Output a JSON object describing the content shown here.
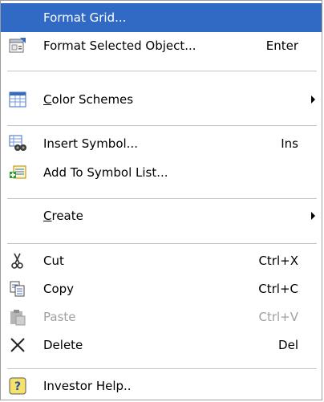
{
  "menu": {
    "format_grid": {
      "label": "Format Grid..."
    },
    "format_selected": {
      "label": "Format Selected Object...",
      "shortcut": "Enter"
    },
    "color_schemes": {
      "label_pre": "",
      "label_accel": "C",
      "label_post": "olor Schemes"
    },
    "insert_symbol": {
      "label": "Insert Symbol...",
      "shortcut": "Ins"
    },
    "add_symbol": {
      "label": "Add To Symbol List..."
    },
    "create": {
      "label_pre": "",
      "label_accel": "C",
      "label_post": "reate"
    },
    "cut": {
      "label": "Cut",
      "shortcut": "Ctrl+X"
    },
    "copy": {
      "label": "Copy",
      "shortcut": "Ctrl+C"
    },
    "paste": {
      "label": "Paste",
      "shortcut": "Ctrl+V",
      "disabled": true
    },
    "delete": {
      "label": "Delete",
      "shortcut": "Del"
    },
    "investor_help": {
      "label": "Investor Help.."
    }
  },
  "colors": {
    "highlight": "#316ac5",
    "disabled_text": "#a0a0a0",
    "separator": "#c5c5c5"
  },
  "icons": {
    "format_selected": "properties-icon",
    "color_schemes": "grid-color-icon",
    "insert_symbol": "binoculars-list-icon",
    "add_symbol": "add-list-icon",
    "cut": "scissors-icon",
    "copy": "copy-icon",
    "paste": "paste-icon",
    "delete": "delete-x-icon",
    "investor_help": "help-icon"
  }
}
